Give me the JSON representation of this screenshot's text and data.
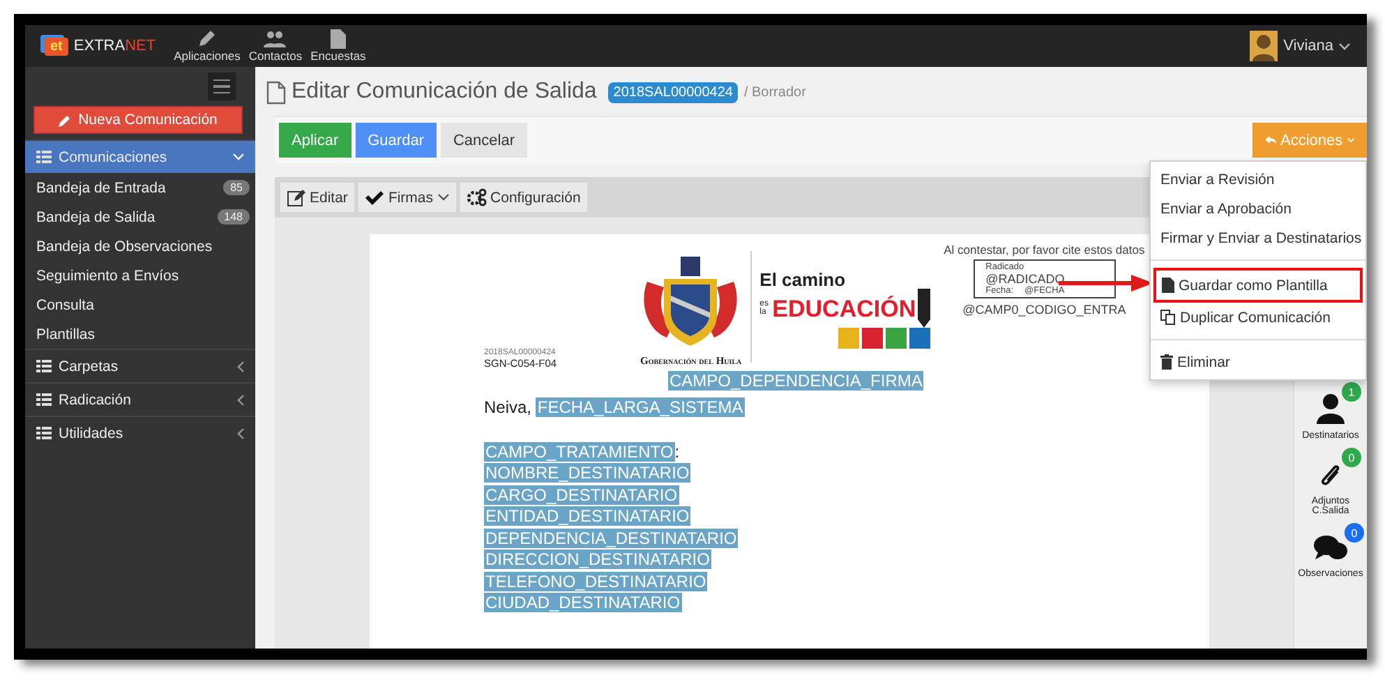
{
  "topbar": {
    "logo": {
      "badge": "et",
      "text_main": "EXTRA",
      "text_accent": "NET"
    },
    "nav": [
      {
        "label": "Aplicaciones",
        "kind": "pencil"
      },
      {
        "label": "Contactos",
        "kind": "users"
      },
      {
        "label": "Encuestas",
        "kind": "file"
      }
    ],
    "user": {
      "name": "Viviana"
    }
  },
  "sidebar": {
    "new_button": "Nueva Comunicación",
    "sections": [
      {
        "label": "Comunicaciones",
        "expanded": true,
        "selected": true,
        "children": [
          {
            "label": "Bandeja de Entrada",
            "count": "85"
          },
          {
            "label": "Bandeja de Salida",
            "count": "148"
          },
          {
            "label": "Bandeja de Observaciones"
          },
          {
            "label": "Seguimiento a Envíos"
          },
          {
            "label": "Consulta"
          },
          {
            "label": "Plantillas"
          }
        ]
      },
      {
        "label": "Carpetas",
        "expanded": false,
        "selected": false
      },
      {
        "label": "Radicación",
        "expanded": false,
        "selected": false
      },
      {
        "label": "Utilidades",
        "expanded": false,
        "selected": false
      }
    ]
  },
  "header": {
    "title": "Editar Comunicación de Salida",
    "code": "2018SAL00000424",
    "status": "/ Borrador"
  },
  "buttons": [
    {
      "label": "Aplicar",
      "kind": "success"
    },
    {
      "label": "Guardar",
      "kind": "primary"
    },
    {
      "label": "Cancelar",
      "kind": "default"
    }
  ],
  "actions": {
    "label": "Acciones",
    "menu": [
      {
        "kind": "item",
        "label": "Enviar a Revisión",
        "highlighted": false
      },
      {
        "kind": "item",
        "label": "Enviar a Aprobación",
        "highlighted": false
      },
      {
        "kind": "item",
        "label": "Firmar y Enviar a Destinatarios",
        "highlighted": false
      },
      {
        "kind": "divider"
      },
      {
        "kind": "item",
        "label": "Guardar como Plantilla",
        "highlighted": true
      },
      {
        "kind": "item",
        "label": "Duplicar Comunicación",
        "highlighted": false
      },
      {
        "kind": "divider"
      },
      {
        "kind": "item",
        "label": "Eliminar",
        "highlighted": false
      }
    ]
  },
  "editor_toolbar": [
    {
      "label": "Editar",
      "dropdown": false
    },
    {
      "label": "Firmas",
      "dropdown": true
    },
    {
      "label": "Configuración",
      "dropdown": false
    }
  ],
  "document": {
    "code": "2018SAL00000424",
    "form_code": "SGN-C054-F04",
    "government": "Gobernación del Huila",
    "campaign": {
      "line1": "El camino",
      "prefix": "es la",
      "line2": "EDUCACIÓN"
    },
    "filing": {
      "note": "Al contestar, por favor cite estos datos",
      "label_radicado": "Radicado",
      "radicado": "@RADICADO",
      "label_fecha": "Fecha:",
      "fecha": "@FECHA",
      "code": "@CAMP0_CODIGO_ENTRA"
    },
    "dependency": "CAMPO_DEPENDENCIA_FIRMA",
    "city": "Neiva,",
    "date": "FECHA_LARGA_SISTEMA",
    "treatment": "CAMPO_TRATAMIENTO",
    "treatment_suffix": ":",
    "recipient_fields": [
      "NOMBRE_DESTINATARIO",
      "CARGO_DESTINATARIO",
      "ENTIDAD_DESTINATARIO",
      "DEPENDENCIA_DESTINATARIO",
      "DIRECCION_DESTINATARIO",
      "TELEFONO_DESTINATARIO",
      "CIUDAD_DESTINATARIO"
    ]
  },
  "side_panel": [
    {
      "label": "Destinatarios",
      "count": "1",
      "color": "#2eaa4a"
    },
    {
      "label": "Adjuntos C.Salida",
      "count": "0",
      "color": "#2eaa4a"
    },
    {
      "label": "Observaciones",
      "count": "0",
      "color": "#1a6ff0"
    }
  ]
}
